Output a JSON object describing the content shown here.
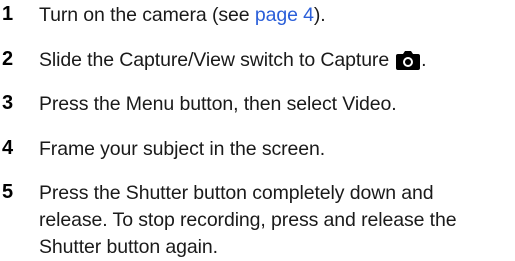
{
  "steps": [
    {
      "number": "1",
      "text_before": "Turn on the camera (see ",
      "link_text": "page 4",
      "text_after": ")."
    },
    {
      "number": "2",
      "text_before": "Slide the Capture/View switch to Capture",
      "icon": "camera-icon",
      "text_after": "."
    },
    {
      "number": "3",
      "text": "Press the Menu button, then select Video."
    },
    {
      "number": "4",
      "text": "Frame your subject in the screen."
    },
    {
      "number": "5",
      "lines": [
        "Press the Shutter button completely down and",
        "release. To stop recording, press and release the",
        "Shutter button again."
      ]
    }
  ],
  "colors": {
    "link": "#2b5fd9",
    "text": "#1a1a1a"
  }
}
